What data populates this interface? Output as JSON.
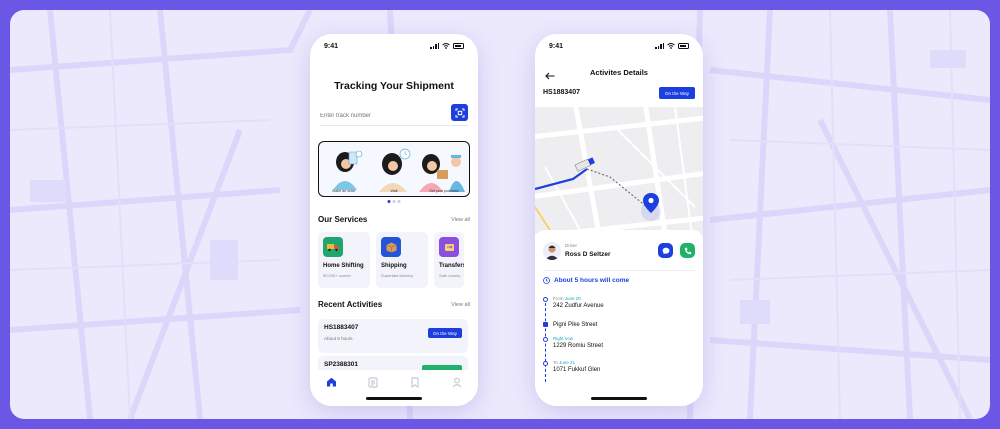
{
  "colors": {
    "accent": "#1d3fe0",
    "green": "#20b26b",
    "frame_bg": "#ece9fd",
    "page_bg": "#6b57e6"
  },
  "status": {
    "time": "9:41"
  },
  "tracking": {
    "title": "Tracking Your Shipment",
    "search_placeholder": "Enter track number",
    "banner_labels": [
      "Make an order",
      "Wait",
      "Get your purchase"
    ],
    "services_title": "Our Services",
    "services_view_all": "View all",
    "services": [
      {
        "title": "Home Shifting",
        "sub": "50,000+ courier",
        "icon": "truck-icon",
        "color": "#1fa66f"
      },
      {
        "title": "Shipping",
        "sub": "Superfast delivery",
        "icon": "box-icon",
        "color": "#2355d8"
      },
      {
        "title": "Transfers",
        "sub": "Safe money",
        "icon": "transfer-icon",
        "color": "#8b4fe0"
      }
    ],
    "activities_title": "Recent Activities",
    "activities_view_all": "View all",
    "activities": [
      {
        "id": "HS1883407",
        "sub": "About 5 hours",
        "status": "On the Way"
      },
      {
        "id": "SP2388301",
        "sub": "",
        "status": ""
      }
    ],
    "tabs": [
      "home-icon",
      "document-icon",
      "bookmark-icon",
      "profile-icon"
    ]
  },
  "details": {
    "title": "Activites Details",
    "order_id": "HS1883407",
    "order_status": "On the Way",
    "driver_caption": "Driver",
    "driver_name": "Ross D Seltzer",
    "eta": "About 5 hours will come",
    "timeline": [
      {
        "caption": "From",
        "date": "June 20",
        "address": "242 Zudfur Avenue"
      },
      {
        "caption": "",
        "date": "",
        "address": "Pigni Pike Street"
      },
      {
        "caption": "Right now",
        "date": "",
        "address": "1229 Romiu Street"
      },
      {
        "caption": "To",
        "date": "June 21",
        "address": "1071 Fukkuf Glen"
      }
    ]
  }
}
